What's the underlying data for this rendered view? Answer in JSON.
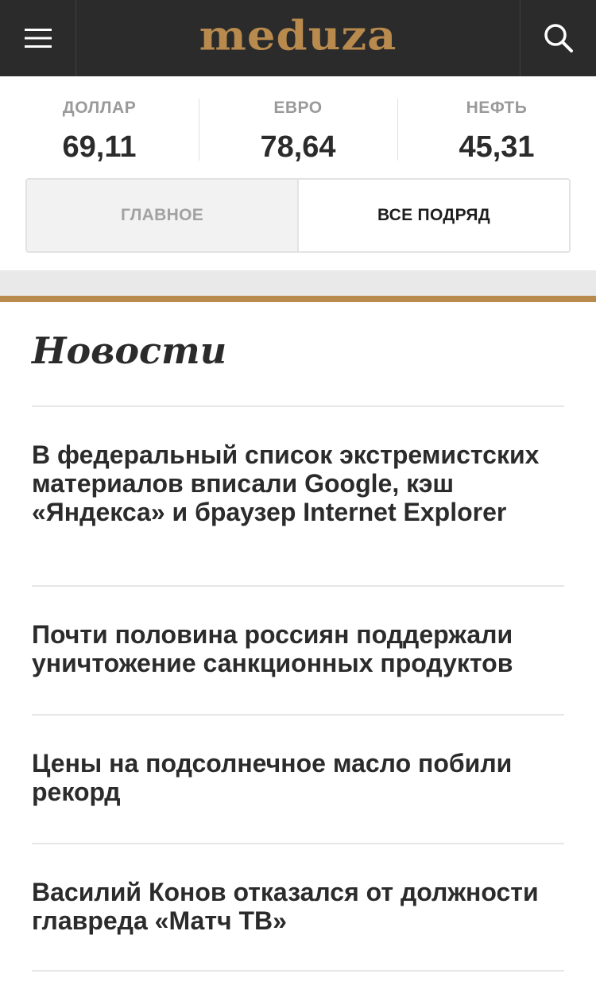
{
  "header": {
    "logo": "meduza",
    "menu_icon": "hamburger-menu-icon",
    "search_icon": "search-icon",
    "background": "#2b2b2b",
    "logo_color": "#b88a4d"
  },
  "rates": [
    {
      "label": "ДОЛЛАР",
      "value": "69,11"
    },
    {
      "label": "ЕВРО",
      "value": "78,64"
    },
    {
      "label": "НЕФТЬ",
      "value": "45,31"
    }
  ],
  "tabs": {
    "main": "ГЛАВНОЕ",
    "all": "ВСЕ ПОДРЯД",
    "active": "all"
  },
  "section": {
    "title": "Новости",
    "accent": "#b88a4d"
  },
  "news": [
    {
      "title": "В федеральный список экстремистских материалов вписали Google, кэш «Яндекса» и браузер Internet Explorer"
    },
    {
      "title": "Почти половина россиян поддержали уничтожение санкционных продуктов"
    },
    {
      "title": "Цены на подсолнечное масло побили рекорд"
    },
    {
      "title": "Василий Конов отказался от должности главреда «Матч ТВ»"
    }
  ]
}
